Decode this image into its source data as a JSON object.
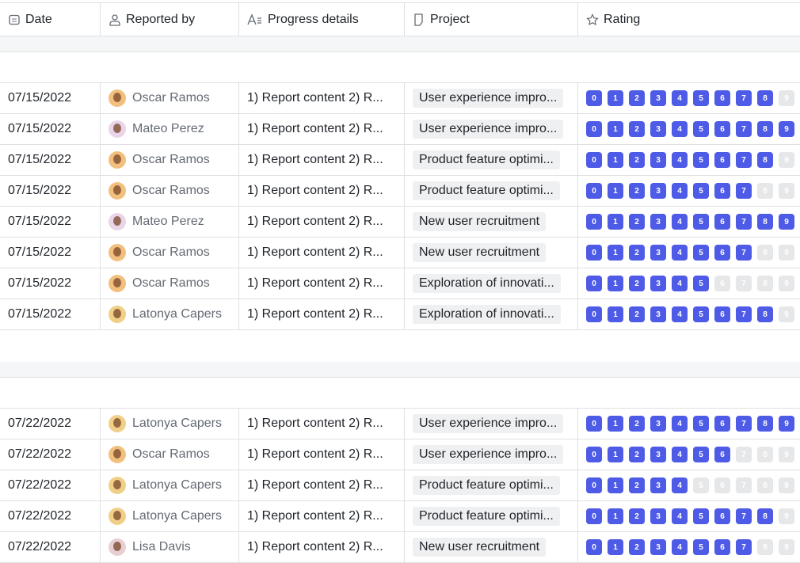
{
  "headers": [
    {
      "label": "Date",
      "icon": "calendar-icon"
    },
    {
      "label": "Reported by",
      "icon": "person-icon"
    },
    {
      "label": "Progress details",
      "icon": "text-icon"
    },
    {
      "label": "Project",
      "icon": "tag-icon"
    },
    {
      "label": "Rating",
      "icon": "star-icon"
    }
  ],
  "colors": {
    "rating_on": "#4e5be6",
    "rating_off": "#e6e7e9"
  },
  "rating_scale": [
    0,
    1,
    2,
    3,
    4,
    5,
    6,
    7,
    8,
    9
  ],
  "groups": [
    {
      "rows": [
        {
          "date": "07/15/2022",
          "reporter": "Oscar Ramos",
          "details": "1) Report content 2) R...",
          "project": "User experience impro...",
          "rating": 8
        },
        {
          "date": "07/15/2022",
          "reporter": "Mateo Perez",
          "details": "1) Report content 2) R...",
          "project": "User experience impro...",
          "rating": 9
        },
        {
          "date": "07/15/2022",
          "reporter": "Oscar Ramos",
          "details": "1) Report content 2) R...",
          "project": "Product feature optimi...",
          "rating": 8
        },
        {
          "date": "07/15/2022",
          "reporter": "Oscar Ramos",
          "details": "1) Report content 2) R...",
          "project": "Product feature optimi...",
          "rating": 7
        },
        {
          "date": "07/15/2022",
          "reporter": "Mateo Perez",
          "details": "1) Report content 2) R...",
          "project": "New user recruitment",
          "rating": 9
        },
        {
          "date": "07/15/2022",
          "reporter": "Oscar Ramos",
          "details": "1) Report content 2) R...",
          "project": "New user recruitment",
          "rating": 7
        },
        {
          "date": "07/15/2022",
          "reporter": "Oscar Ramos",
          "details": "1) Report content 2) R...",
          "project": "Exploration of innovati...",
          "rating": 5
        },
        {
          "date": "07/15/2022",
          "reporter": "Latonya Capers",
          "details": "1) Report content 2) R...",
          "project": "Exploration of innovati...",
          "rating": 8
        }
      ]
    },
    {
      "rows": [
        {
          "date": "07/22/2022",
          "reporter": "Latonya Capers",
          "details": "1) Report content 2) R...",
          "project": "User experience impro...",
          "rating": 9
        },
        {
          "date": "07/22/2022",
          "reporter": "Oscar Ramos",
          "details": "1) Report content 2) R...",
          "project": "User experience impro...",
          "rating": 6
        },
        {
          "date": "07/22/2022",
          "reporter": "Latonya Capers",
          "details": "1) Report content 2) R...",
          "project": "Product feature optimi...",
          "rating": 4
        },
        {
          "date": "07/22/2022",
          "reporter": "Latonya Capers",
          "details": "1) Report content 2) R...",
          "project": "Product feature optimi...",
          "rating": 8
        },
        {
          "date": "07/22/2022",
          "reporter": "Lisa Davis",
          "details": "1) Report content 2) R...",
          "project": "New user recruitment",
          "rating": 7
        }
      ]
    }
  ]
}
